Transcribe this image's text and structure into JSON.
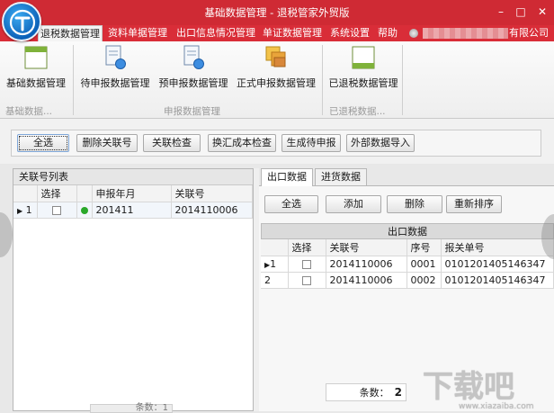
{
  "window": {
    "title": "基础数据管理 - 退税管家外贸版",
    "controls": {
      "minimize": "–",
      "maximize": "□",
      "close": "✕"
    }
  },
  "menu": {
    "tabs": [
      {
        "label": "退税数据管理"
      },
      {
        "label": "资料单据管理"
      },
      {
        "label": "出口信息情况管理"
      },
      {
        "label": "单证数据管理"
      },
      {
        "label": "系统设置"
      },
      {
        "label": "帮助"
      }
    ],
    "company_suffix": "有限公司"
  },
  "ribbon": {
    "buttons": [
      {
        "label": "基础数据管理",
        "icon": "window-icon"
      },
      {
        "label": "待申报数据管理",
        "icon": "document-gear-icon"
      },
      {
        "label": "预申报数据管理",
        "icon": "document-gear-icon"
      },
      {
        "label": "正式申报数据管理",
        "icon": "stacked-cards-icon"
      },
      {
        "label": "已退税数据管理",
        "icon": "window-green-icon"
      }
    ],
    "groups": [
      {
        "label": "基础数据..."
      },
      {
        "label": "申报数据管理"
      },
      {
        "label": "已退税数据..."
      }
    ]
  },
  "toolbar": {
    "buttons": [
      {
        "label": "全选"
      },
      {
        "label": "删除关联号"
      },
      {
        "label": "关联检查"
      },
      {
        "label": "换汇成本检查"
      },
      {
        "label": "生成待申报"
      },
      {
        "label": "外部数据导入"
      }
    ]
  },
  "left_panel": {
    "title": "关联号列表",
    "columns": [
      "",
      "选择",
      "",
      "申报年月",
      "关联号"
    ],
    "rows": [
      {
        "index": "1",
        "period": "201411",
        "relation_no": "2014110006"
      }
    ],
    "footer_label": "条数：",
    "footer_count": "1"
  },
  "right_panel": {
    "tabs": [
      {
        "label": "出口数据"
      },
      {
        "label": "进货数据"
      }
    ],
    "buttons": [
      {
        "label": "全选"
      },
      {
        "label": "添加"
      },
      {
        "label": "删除"
      },
      {
        "label": "重新排序"
      }
    ],
    "caption": "出口数据",
    "columns": [
      "",
      "选择",
      "关联号",
      "序号",
      "报关单号"
    ],
    "rows": [
      {
        "index": "1",
        "relation_no": "2014110006",
        "seq": "0001",
        "customs_no": "0101201405146347"
      },
      {
        "index": "2",
        "relation_no": "2014110006",
        "seq": "0002",
        "customs_no": "0101201405146347"
      }
    ],
    "footer_label": "条数：",
    "footer_count": "2"
  },
  "watermark": {
    "text": "下载吧",
    "sub": "www.xiazaiba.com"
  },
  "colors": {
    "title_red": "#cf2a34",
    "menu_red": "#d92d38",
    "status_green": "#2aa82a"
  }
}
